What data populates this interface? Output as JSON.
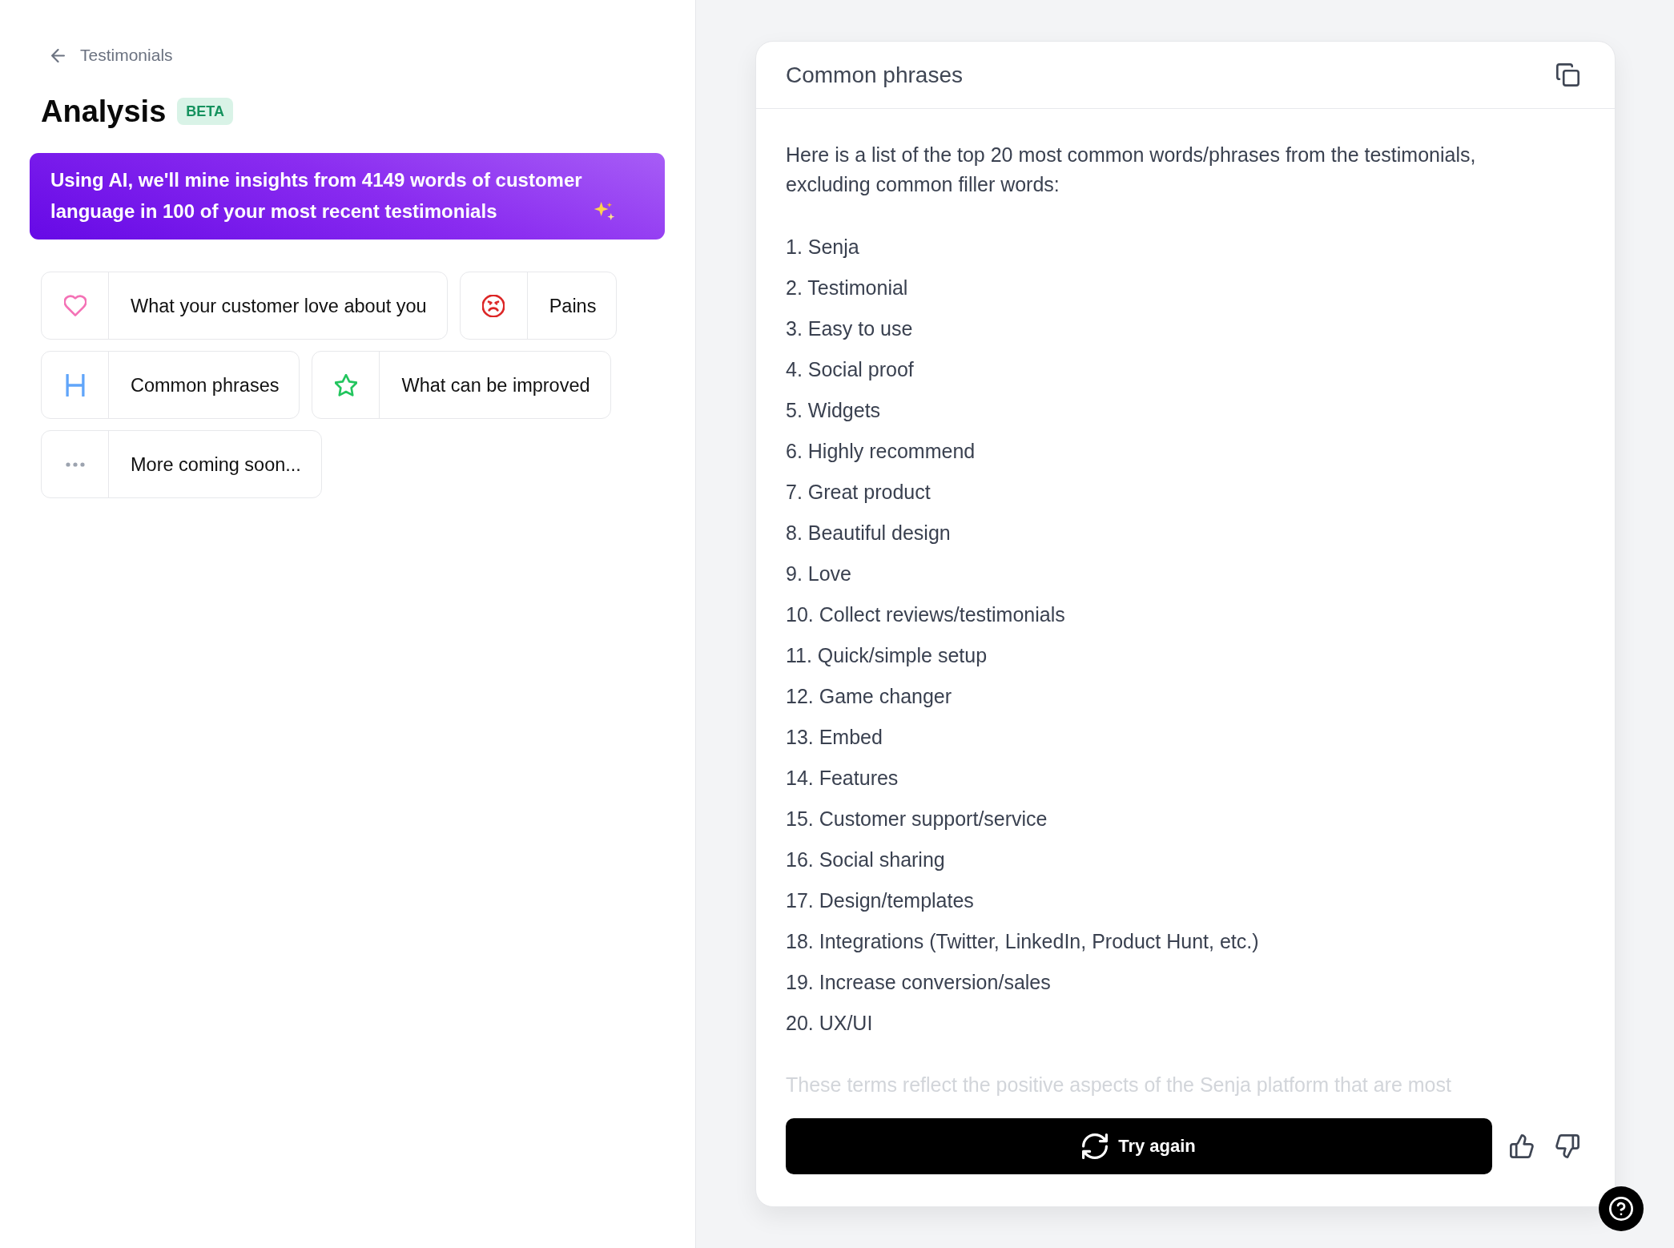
{
  "back_link": {
    "label": "Testimonials"
  },
  "page": {
    "title": "Analysis",
    "badge": "BETA"
  },
  "banner": {
    "text": "Using AI, we'll mine insights from 4149 words of customer language in 100 of your most recent testimonials"
  },
  "analyses": [
    {
      "label": "What your customer love about you"
    },
    {
      "label": "Pains"
    },
    {
      "label": "Common phrases"
    },
    {
      "label": "What can be improved"
    },
    {
      "label": "More coming soon..."
    }
  ],
  "result": {
    "title": "Common phrases",
    "intro": "Here is a list of the top 20 most common words/phrases from the testimonials, excluding common filler words:",
    "items": [
      "1. Senja",
      "2. Testimonial",
      "3. Easy to use",
      "4. Social proof",
      "5. Widgets",
      "6. Highly recommend",
      "7. Great product",
      "8. Beautiful design",
      "9. Love",
      "10. Collect reviews/testimonials",
      "11. Quick/simple setup",
      "12. Game changer",
      "13. Embed",
      "14. Features",
      "15. Customer support/service",
      "16. Social sharing",
      "17. Design/templates",
      "18. Integrations (Twitter, LinkedIn, Product Hunt, etc.)",
      "19. Increase conversion/sales",
      "20. UX/UI"
    ],
    "closing": "These terms reflect the positive aspects of the Senja platform that are most",
    "retry_button": "Try again"
  }
}
